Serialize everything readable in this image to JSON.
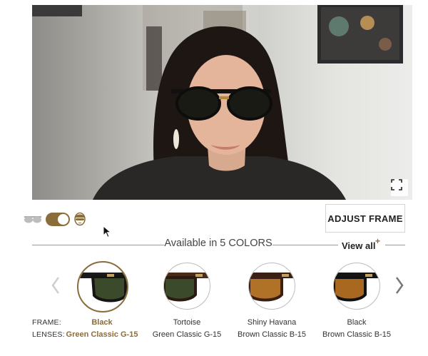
{
  "toolbar": {
    "adjust_label": "ADJUST FRAME"
  },
  "colors_bar": {
    "available_text": "Available in 5 COLORS",
    "view_all_label": "View all",
    "view_all_plus": "+"
  },
  "labels": {
    "frame": "FRAME:",
    "lenses": "LENSES:"
  },
  "options": [
    {
      "frame": "Black",
      "lenses": "Green Classic G-15",
      "selected": true
    },
    {
      "frame": "Tortoise",
      "lenses": "Green Classic G-15",
      "selected": false
    },
    {
      "frame": "Shiny Havana",
      "lenses": "Brown Classic B-15",
      "selected": false
    },
    {
      "frame": "Black",
      "lenses": "Brown Classic B-15",
      "selected": false
    }
  ],
  "toggle": {
    "mode": "face",
    "on": true
  },
  "icons": {
    "mode_glasses": "glasses-icon",
    "mode_face": "face-icon",
    "fullscreen": "fullscreen-icon",
    "prev": "chevron-left-icon",
    "next": "chevron-right-icon"
  },
  "theme": {
    "accent": "#8a6d3b",
    "border": "#bdbdbd"
  }
}
